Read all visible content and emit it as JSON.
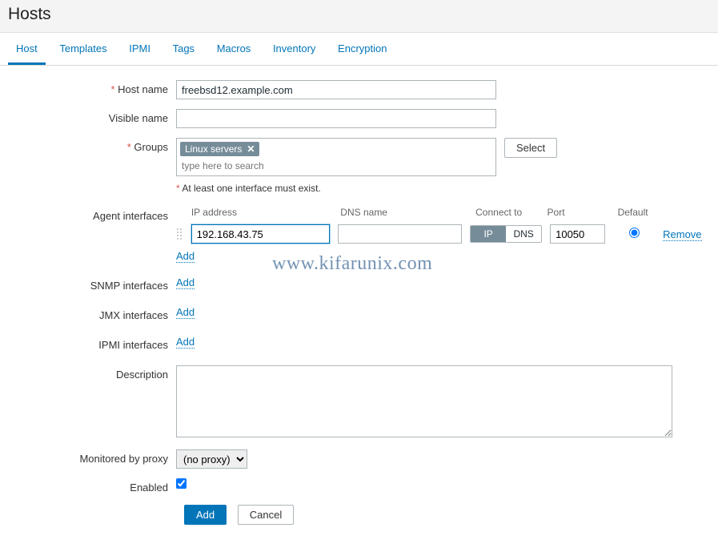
{
  "page_title": "Hosts",
  "tabs": {
    "host": "Host",
    "templates": "Templates",
    "ipmi": "IPMI",
    "tags": "Tags",
    "macros": "Macros",
    "inventory": "Inventory",
    "encryption": "Encryption"
  },
  "labels": {
    "host_name": "Host name",
    "visible_name": "Visible name",
    "groups": "Groups",
    "agent_interfaces": "Agent interfaces",
    "snmp_interfaces": "SNMP interfaces",
    "jmx_interfaces": "JMX interfaces",
    "ipmi_interfaces": "IPMI interfaces",
    "description": "Description",
    "monitored_by_proxy": "Monitored by proxy",
    "enabled": "Enabled"
  },
  "fields": {
    "host_name": "freebsd12.example.com",
    "visible_name": "",
    "groups_tag": "Linux servers",
    "groups_placeholder": "type here to search",
    "select_btn": "Select",
    "interface_hint": "At least one interface must exist.",
    "description": "",
    "proxy": "(no proxy)",
    "enabled": true
  },
  "iface_headers": {
    "ip": "IP address",
    "dns": "DNS name",
    "connect": "Connect to",
    "port": "Port",
    "default": "Default"
  },
  "agent_iface": {
    "ip": "192.168.43.75",
    "dns": "",
    "connect_ip": "IP",
    "connect_dns": "DNS",
    "port": "10050",
    "remove": "Remove"
  },
  "links": {
    "add": "Add"
  },
  "buttons": {
    "add": "Add",
    "cancel": "Cancel"
  },
  "watermark": "www.kifarunix.com"
}
